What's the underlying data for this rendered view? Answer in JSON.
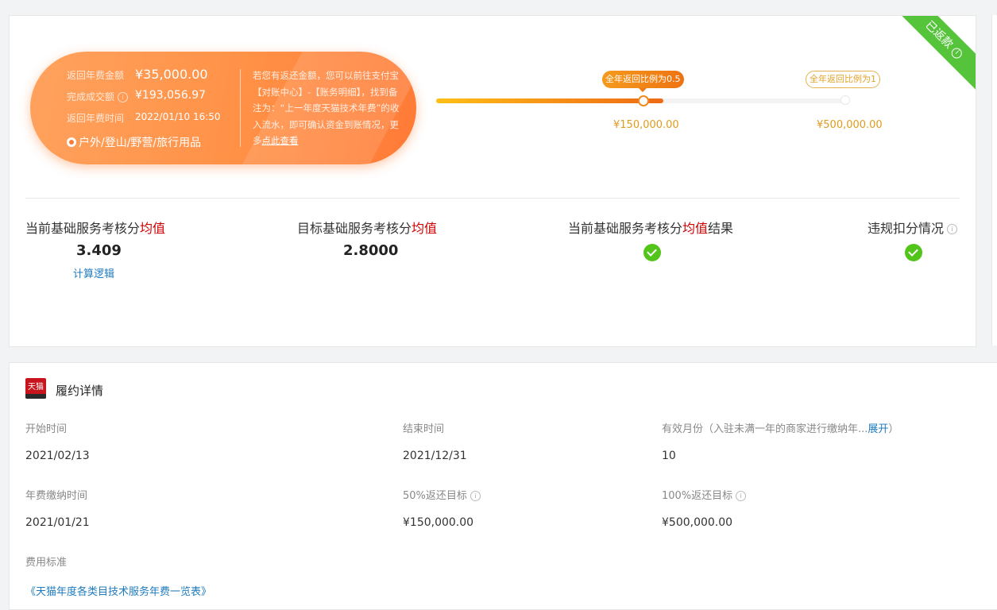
{
  "badge": {
    "label": "已返款",
    "icon": "info-icon"
  },
  "pill": {
    "rows": [
      {
        "label": "返回年费金额",
        "value": "¥35,000.00"
      },
      {
        "label": "完成成交额",
        "value": "¥193,056.97"
      },
      {
        "label": "返回年费时间",
        "value": "2022/01/10 16:50"
      }
    ],
    "category": "户外/登山/野营/旅行用品",
    "note_text": "若您有返还金额，您可以前往支付宝【对账中心】-【账务明细】，找到备注为：“上一年度天猫技术年费”的收入流水，即可确认资金到账情况，更多",
    "note_link": "点此查看"
  },
  "progress": {
    "fill_ratio": 0.55,
    "milestones": [
      {
        "tip": "全年返回比例为0.5",
        "amount": "¥150,000.00"
      },
      {
        "tip": "全年返回比例为1",
        "amount": "¥500,000.00"
      }
    ]
  },
  "metrics": [
    {
      "pre": "当前基础服务考核分",
      "hl": "均值",
      "post": "",
      "value": "3.409",
      "link": "计算逻辑"
    },
    {
      "pre": "目标基础服务考核分",
      "hl": "均值",
      "post": "",
      "value": "2.8000"
    },
    {
      "pre": "当前基础服务考核分",
      "hl": "均值",
      "post": "结果",
      "status": "check-icon"
    },
    {
      "pre": "违规扣分情况",
      "status": "check-icon",
      "icon": "info-icon"
    }
  ],
  "details": {
    "logo_text": "天猫",
    "title": "履约详情",
    "start_label": "开始时间",
    "start_value": "2021/02/13",
    "end_label": "结束时间",
    "end_value": "2021/12/31",
    "months_label": "有效月份（入驻未满一年的商家进行缴纳年...",
    "months_expand": "展开",
    "months_close": "）",
    "months_value": "10",
    "pay_label": "年费缴纳时间",
    "pay_value": "2021/01/21",
    "t50_label": "50%返还目标",
    "t50_value": "¥150,000.00",
    "t100_label": "100%返还目标",
    "t100_value": "¥500,000.00",
    "fee_label": "费用标准",
    "fee_link": "《天猫年度各类目技术服务年费一览表》"
  }
}
